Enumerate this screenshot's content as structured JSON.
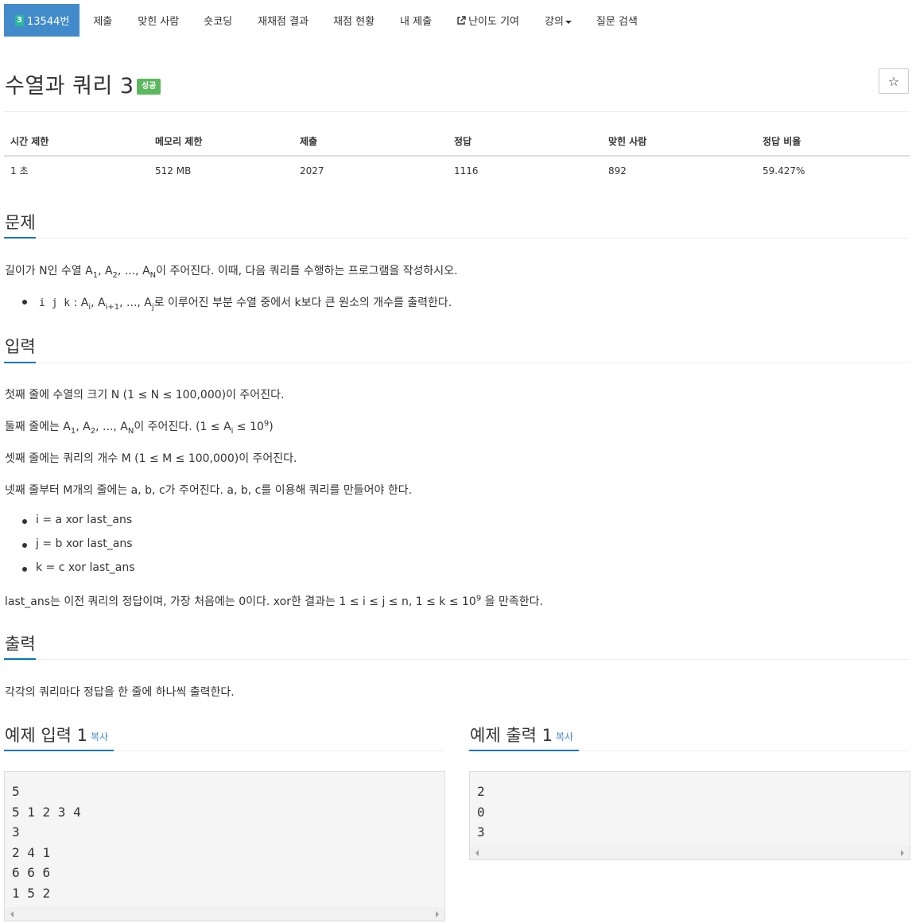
{
  "nav": {
    "problem_badge": "3",
    "problem_id": "13544번",
    "items": [
      "제출",
      "맞힌 사람",
      "숏코딩",
      "재채점 결과",
      "채점 현황",
      "내 제출",
      "난이도 기여",
      "강의",
      "질문 검색"
    ],
    "external_icon": "external-link-icon"
  },
  "title": "수열과 쿼리 3",
  "result_badge": "성공",
  "star_icon": "☆",
  "info": {
    "headers": [
      "시간 제한",
      "메모리 제한",
      "제출",
      "정답",
      "맞힌 사람",
      "정답 비율"
    ],
    "values": [
      "1 초",
      "512 MB",
      "2027",
      "1116",
      "892",
      "59.427%"
    ]
  },
  "sections": {
    "problem": "문제",
    "input": "입력",
    "output": "출력"
  },
  "problem_text": {
    "p1_before": "길이가 N인 수열 A",
    "p1_sub1": "1",
    "p1_mid1": ", A",
    "p1_sub2": "2",
    "p1_mid2": ", ..., A",
    "p1_sub3": "N",
    "p1_after": "이 주어진다. 이때, 다음 쿼리를 수행하는 프로그램을 작성하시오.",
    "li_code": "i j k",
    "li_mid1": ": A",
    "li_sub1": "i",
    "li_mid2": ", A",
    "li_sub2": "i+1",
    "li_mid3": ", ..., A",
    "li_sub3": "j",
    "li_after": "로 이루어진 부분 수열 중에서 k보다 큰 원소의 개수를 출력한다."
  },
  "input_text": {
    "l1": "첫째 줄에 수열의 크기 N (1 ≤ N ≤ 100,000)이 주어진다.",
    "l2_before": "둘째 줄에는 A",
    "l2_sub1": "1",
    "l2_mid1": ", A",
    "l2_sub2": "2",
    "l2_mid2": ", ..., A",
    "l2_sub3": "N",
    "l2_mid3": "이 주어진다. (1 ≤ A",
    "l2_sub4": "i",
    "l2_mid4": " ≤ 10",
    "l2_sup": "9",
    "l2_after": ")",
    "l3": "셋째 줄에는 쿼리의 개수 M (1 ≤ M ≤ 100,000)이 주어진다.",
    "l4": "넷째 줄부터 M개의 줄에는 a, b, c가 주어진다. a, b, c를 이용해 쿼리를 만들어야 한다.",
    "b1": "i = a xor last_ans",
    "b2": "j = b xor last_ans",
    "b3": "k = c xor last_ans",
    "l5_before": "last_ans는 이전 쿼리의 정답이며, 가장 처음에는 0이다. xor한 결과는 1 ≤ i ≤ j ≤ n, 1 ≤ k ≤ 10",
    "l5_sup": "9",
    "l5_after": " 을 만족한다."
  },
  "output_text": "각각의 쿼리마다 정답을 한 줄에 하나씩 출력한다.",
  "samples": {
    "input_title": "예제 입력 1",
    "output_title": "예제 출력 1",
    "copy_label": "복사",
    "input": "5\n5 1 2 3 4\n3\n2 4 1\n6 6 6\n1 5 2",
    "output": "2\n0\n3"
  }
}
